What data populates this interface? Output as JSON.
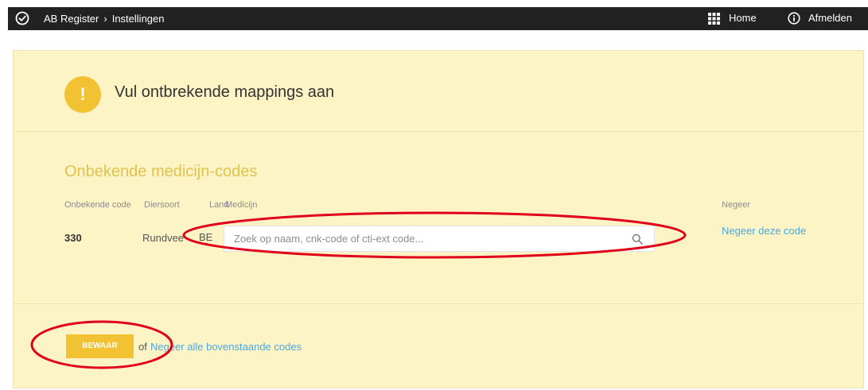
{
  "topbar": {
    "breadcrumb_root": "AB Register",
    "breadcrumb_separator": "›",
    "breadcrumb_current": "Instellingen",
    "home_label": "Home",
    "logout_label": "Afmelden",
    "icons": [
      "check-circle-icon",
      "grid-icon",
      "info-icon"
    ]
  },
  "alert": {
    "icon_glyph": "!",
    "title": "Vul ontbrekende mappings aan"
  },
  "section": {
    "title": "Onbekende medicijn-codes",
    "columns": {
      "code": "Onbekende code",
      "species": "Diersoort",
      "land": "Land",
      "medicine": "Medicijn",
      "ignore": "Negeer"
    },
    "rows": [
      {
        "code": "330",
        "species": "Rundvee",
        "land": "BE",
        "search_placeholder": "Zoek op naam, cnk-code of cti-ext code...",
        "search_value": "",
        "ignore_link": "Negeer deze code"
      }
    ]
  },
  "footer": {
    "save_label": "BEWAAR",
    "or_text": "of",
    "ignore_all_label": "Negeer alle bovenstaande codes"
  },
  "colors": {
    "topbar": "#222222",
    "panel": "#fdf4c6",
    "accent": "#f2c233",
    "section_title": "#e2c24d",
    "link": "#4aa8e0",
    "annotation": "#e0001a"
  }
}
